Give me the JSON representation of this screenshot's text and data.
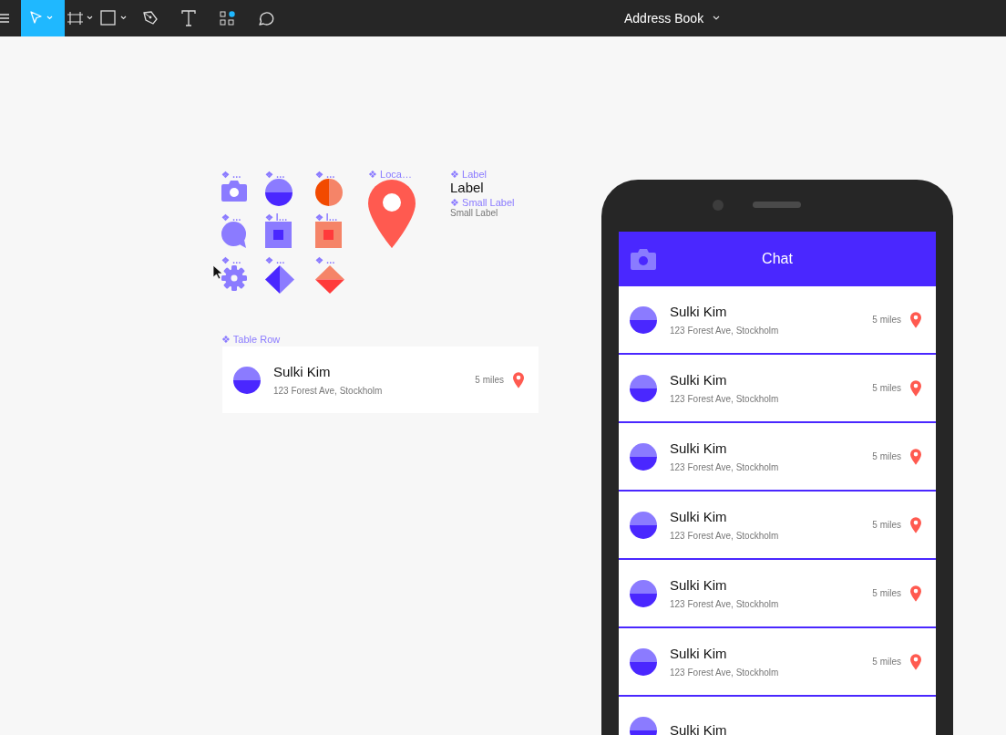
{
  "toolbar": {
    "tools": [
      {
        "kind": "menu",
        "selected": false
      },
      {
        "kind": "select",
        "selected": true
      },
      {
        "kind": "frame",
        "selected": false
      },
      {
        "kind": "rectangle",
        "selected": false
      },
      {
        "kind": "pen",
        "selected": false
      },
      {
        "kind": "text",
        "selected": false
      },
      {
        "kind": "components",
        "selected": false
      },
      {
        "kind": "comment",
        "selected": false
      }
    ],
    "document_title": "Address Book"
  },
  "components": [
    {
      "label": "❖ …",
      "kind": "camera"
    },
    {
      "label": "❖ …",
      "kind": "half-circle"
    },
    {
      "label": "❖ …",
      "kind": "split-circle"
    },
    {
      "label": "❖ …",
      "kind": "chat"
    },
    {
      "label": "❖ I…",
      "kind": "square-purple"
    },
    {
      "label": "❖ I…",
      "kind": "square-coral"
    },
    {
      "label": "❖ …",
      "kind": "gear"
    },
    {
      "label": "❖ …",
      "kind": "diamond-purple"
    },
    {
      "label": "❖ …",
      "kind": "diamond-coral"
    }
  ],
  "location_component": {
    "label": "❖ Loca…"
  },
  "label_components": [
    {
      "label": "❖ Label",
      "sample": "Label",
      "kind": "large"
    },
    {
      "label": "❖ Small Label",
      "sample": "Small Label",
      "kind": "small"
    }
  ],
  "table_row_component": {
    "label": "❖ Table Row",
    "name": "Sulki Kim",
    "address": "123 Forest Ave, Stockholm",
    "distance": "5 miles"
  },
  "phone": {
    "title": "Chat",
    "rows": [
      {
        "name": "Sulki Kim",
        "address": "123 Forest Ave, Stockholm",
        "distance": "5 miles"
      },
      {
        "name": "Sulki Kim",
        "address": "123 Forest Ave, Stockholm",
        "distance": "5 miles"
      },
      {
        "name": "Sulki Kim",
        "address": "123 Forest Ave, Stockholm",
        "distance": "5 miles"
      },
      {
        "name": "Sulki Kim",
        "address": "123 Forest Ave, Stockholm",
        "distance": "5 miles"
      },
      {
        "name": "Sulki Kim",
        "address": "123 Forest Ave, Stockholm",
        "distance": "5 miles"
      },
      {
        "name": "Sulki Kim",
        "address": "123 Forest Ave, Stockholm",
        "distance": "5 miles"
      },
      {
        "name": "Sulki Kim"
      }
    ]
  }
}
